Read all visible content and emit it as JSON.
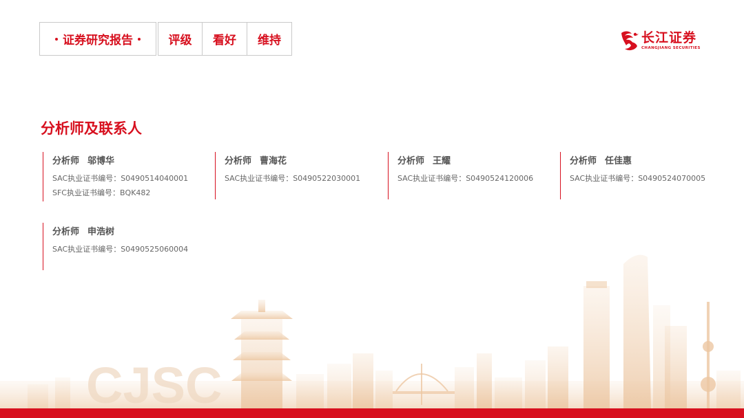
{
  "header": {
    "report_type": "证券研究报告",
    "rating_items": [
      "评级",
      "看好",
      "维持"
    ]
  },
  "brand": {
    "name_cn": "长江证券",
    "name_en": "CHANGJIANG SECURITIES",
    "watermark": "CJSC",
    "accent_color": "#d7101f"
  },
  "section": {
    "title": "分析师及联系人"
  },
  "analysts": [
    {
      "role": "分析师",
      "name": "邬博华",
      "lines": [
        "SAC执业证书编号：S0490514040001",
        "SFC执业证书编号：BQK482"
      ]
    },
    {
      "role": "分析师",
      "name": "曹海花",
      "lines": [
        "SAC执业证书编号：S0490522030001"
      ]
    },
    {
      "role": "分析师",
      "name": "王耀",
      "lines": [
        "SAC执业证书编号：S0490524120006"
      ]
    },
    {
      "role": "分析师",
      "name": "任佳惠",
      "lines": [
        "SAC执业证书编号：S0490524070005"
      ]
    },
    {
      "role": "分析师",
      "name": "申浩树",
      "lines": [
        "SAC执业证书编号：S0490525060004"
      ]
    }
  ]
}
